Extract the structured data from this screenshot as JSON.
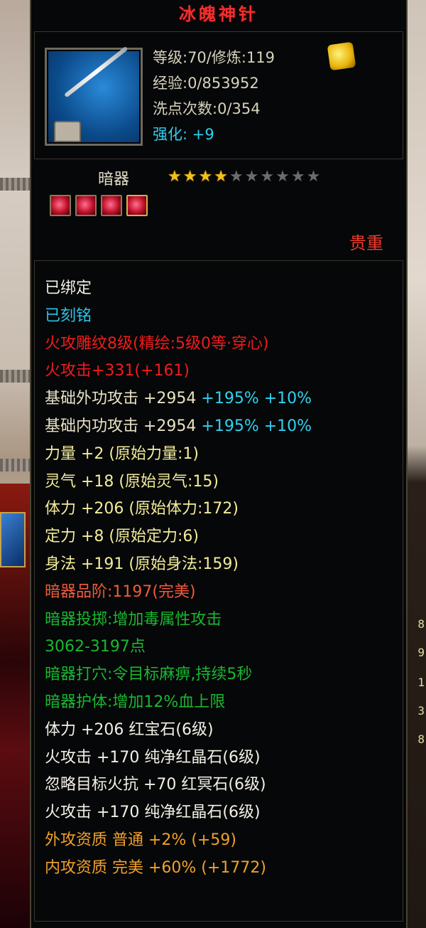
{
  "item": {
    "name": "冰魄神针",
    "level_line": "等级:70/修炼:119",
    "exp_line": "经验:0/853952",
    "reset_line": "洗点次数:0/354",
    "enhance_label": "强化:",
    "enhance_value": "+9",
    "type": "暗器",
    "stars_filled": 4,
    "stars_total": 10,
    "rarity": "贵重",
    "gem_slots": 4,
    "colors": {
      "title": "#f03030",
      "cyan": "#28c6ee",
      "red": "#f01c1c",
      "green": "#18b830",
      "orange": "#f0a02c",
      "star_on": "#f2c21a"
    },
    "icon": "silver-needle-icon"
  },
  "details": {
    "bound": "已绑定",
    "engraved": "已刻铭",
    "carving": "火攻雕纹8级(精绘:5级0等·穿心)",
    "fire_attack": "火攻击+331(+161)",
    "ext_attack_base": "基础外功攻击 +2954 ",
    "ext_attack_bonus": "+195% +10%",
    "int_attack_base": "基础内功攻击 +2954 ",
    "int_attack_bonus": "+195% +10%",
    "strength": "力量 +2 (原始力量:1)",
    "spirit": "灵气 +18 (原始灵气:15)",
    "vitality": "体力 +206 (原始体力:172)",
    "focus": "定力 +8 (原始定力:6)",
    "agility": "身法 +191 (原始身法:159)",
    "grade": "暗器品阶:1197(完美)",
    "throw_1": "暗器投掷:增加毒属性攻击",
    "throw_2": "3062-3197点",
    "acupoint": "暗器打穴:令目标麻痹,持续5秒",
    "protect": "暗器护体:增加12%血上限",
    "gem_1": "体力 +206 红宝石(6级)",
    "gem_2": "火攻击 +170 纯净红晶石(6级)",
    "gem_3": "忽略目标火抗 +70 红冥石(6级)",
    "gem_4": "火攻击 +170 纯净红晶石(6级)",
    "ext_quality": "外攻资质  普通 +2% (+59)",
    "int_quality": "内攻资质  完美 +60% (+1772)"
  },
  "background": {
    "right_numbers": [
      "8",
      "9",
      "1",
      "3",
      "8"
    ]
  }
}
